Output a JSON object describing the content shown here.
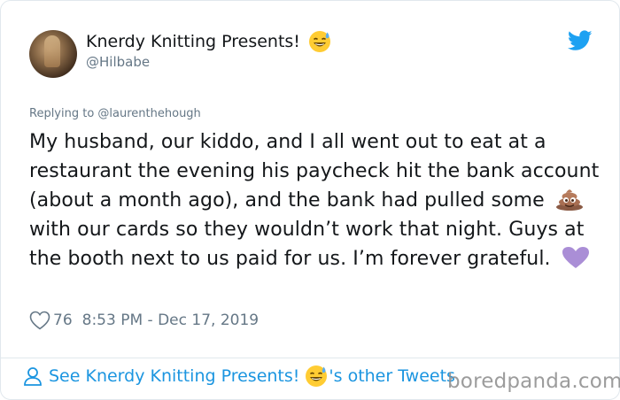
{
  "tweet": {
    "author_name": "Knerdy Knitting Presents!",
    "author_handle": "@Hilbabe",
    "replying_to": "Replying to @laurenthehough",
    "text_parts": [
      "My husband, our kiddo, and I all went out to eat at a restaurant the evening his paycheck hit the bank account (about a month ago), and the bank had pulled some",
      "with our cards so they wouldn’t work that night. Guys at the booth next to us paid for us. I’m forever grateful."
    ],
    "likes": "76",
    "timestamp": "8:53 PM - Dec 17, 2019"
  },
  "footer": {
    "see_more_prefix": "See Knerdy Knitting Presents!",
    "see_more_suffix": "'s other Tweets"
  },
  "watermark": "boredpanda.com",
  "icons": {
    "author_emoji": "sweat-smile-emoji",
    "inline_emoji_1": "poop-emoji",
    "inline_emoji_2": "purple-heart-emoji",
    "brand": "twitter-bird-icon",
    "like": "heart-outline-icon",
    "profile": "person-icon"
  },
  "colors": {
    "link": "#1b95e0",
    "muted": "#657786",
    "text": "#14171a",
    "twitter_blue": "#1da1f2",
    "purple_heart": "#aa8ed6"
  }
}
